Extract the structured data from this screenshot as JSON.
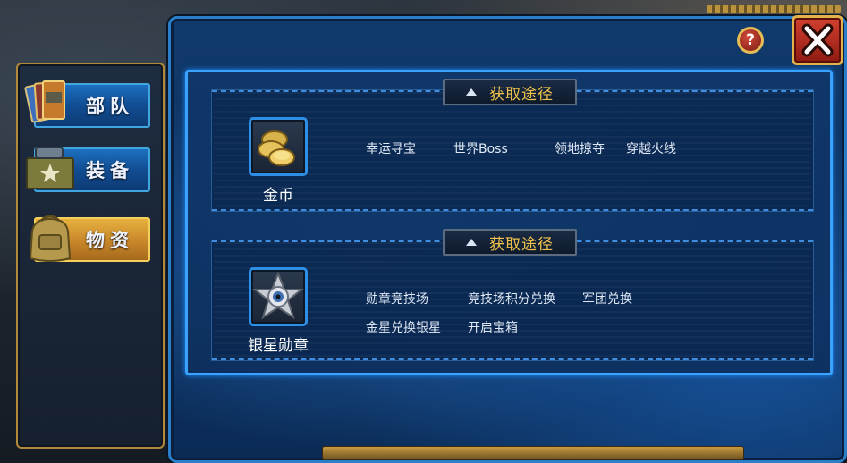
{
  "tabs": [
    {
      "label": "部队",
      "icon": "troop-cards-icon",
      "active": false
    },
    {
      "label": "装备",
      "icon": "equipment-crate-icon",
      "active": false
    },
    {
      "label": "物资",
      "icon": "supply-backpack-icon",
      "active": true
    }
  ],
  "buttons": {
    "help_label": "?"
  },
  "cards": [
    {
      "header": "获取途径",
      "item_name": "金币",
      "item_icon": "gold-coins-icon",
      "sources": [
        "幸运寻宝",
        "世界Boss",
        "领地掠夺",
        "穿越火线"
      ]
    },
    {
      "header": "获取途径",
      "item_name": "银星勋章",
      "item_icon": "silver-star-medal-icon",
      "sources": [
        "勋章竞技场",
        "竞技场积分兑换",
        "军团兑换",
        "金星兑换银星",
        "开启宝箱"
      ]
    }
  ]
}
